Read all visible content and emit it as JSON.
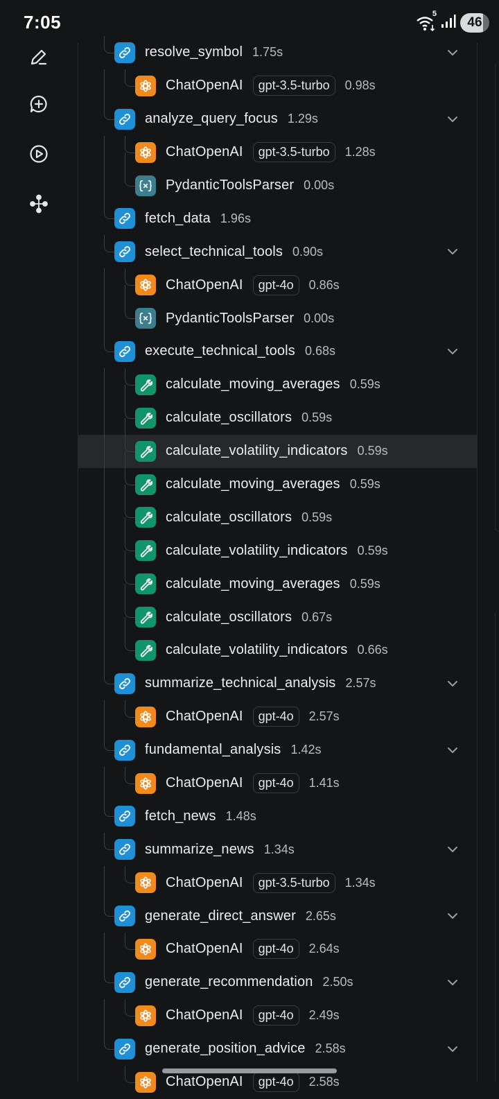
{
  "status_bar": {
    "time": "7:05",
    "wifi_badge": "5",
    "battery": "46"
  },
  "rail": {
    "icons": [
      "edit-icon",
      "new-chat-icon",
      "play-icon",
      "graph-icon"
    ]
  },
  "tree": [
    {
      "level": 0,
      "kind": "chain",
      "name": "resolve_symbol",
      "duration": "1.75s",
      "chevron": true
    },
    {
      "level": 1,
      "kind": "llm",
      "name": "ChatOpenAI",
      "model": "gpt-3.5-turbo",
      "duration": "0.98s"
    },
    {
      "level": 0,
      "kind": "chain",
      "name": "analyze_query_focus",
      "duration": "1.29s",
      "chevron": true
    },
    {
      "level": 1,
      "kind": "llm",
      "name": "ChatOpenAI",
      "model": "gpt-3.5-turbo",
      "duration": "1.28s"
    },
    {
      "level": 1,
      "kind": "parser",
      "name": "PydanticToolsParser",
      "duration": "0.00s"
    },
    {
      "level": 0,
      "kind": "chain",
      "name": "fetch_data",
      "duration": "1.96s",
      "chevron": false
    },
    {
      "level": 0,
      "kind": "chain",
      "name": "select_technical_tools",
      "duration": "0.90s",
      "chevron": true
    },
    {
      "level": 1,
      "kind": "llm",
      "name": "ChatOpenAI",
      "model": "gpt-4o",
      "duration": "0.86s"
    },
    {
      "level": 1,
      "kind": "parser",
      "name": "PydanticToolsParser",
      "duration": "0.00s"
    },
    {
      "level": 0,
      "kind": "chain",
      "name": "execute_technical_tools",
      "duration": "0.68s",
      "chevron": true
    },
    {
      "level": 1,
      "kind": "tool",
      "name": "calculate_moving_averages",
      "duration": "0.59s"
    },
    {
      "level": 1,
      "kind": "tool",
      "name": "calculate_oscillators",
      "duration": "0.59s"
    },
    {
      "level": 1,
      "kind": "tool",
      "name": "calculate_volatility_indicators",
      "duration": "0.59s",
      "highlighted": true
    },
    {
      "level": 1,
      "kind": "tool",
      "name": "calculate_moving_averages",
      "duration": "0.59s"
    },
    {
      "level": 1,
      "kind": "tool",
      "name": "calculate_oscillators",
      "duration": "0.59s"
    },
    {
      "level": 1,
      "kind": "tool",
      "name": "calculate_volatility_indicators",
      "duration": "0.59s"
    },
    {
      "level": 1,
      "kind": "tool",
      "name": "calculate_moving_averages",
      "duration": "0.59s"
    },
    {
      "level": 1,
      "kind": "tool",
      "name": "calculate_oscillators",
      "duration": "0.67s"
    },
    {
      "level": 1,
      "kind": "tool",
      "name": "calculate_volatility_indicators",
      "duration": "0.66s"
    },
    {
      "level": 0,
      "kind": "chain",
      "name": "summarize_technical_analysis",
      "duration": "2.57s",
      "chevron": true
    },
    {
      "level": 1,
      "kind": "llm",
      "name": "ChatOpenAI",
      "model": "gpt-4o",
      "duration": "2.57s"
    },
    {
      "level": 0,
      "kind": "chain",
      "name": "fundamental_analysis",
      "duration": "1.42s",
      "chevron": true
    },
    {
      "level": 1,
      "kind": "llm",
      "name": "ChatOpenAI",
      "model": "gpt-4o",
      "duration": "1.41s"
    },
    {
      "level": 0,
      "kind": "chain",
      "name": "fetch_news",
      "duration": "1.48s",
      "chevron": false
    },
    {
      "level": 0,
      "kind": "chain",
      "name": "summarize_news",
      "duration": "1.34s",
      "chevron": true
    },
    {
      "level": 1,
      "kind": "llm",
      "name": "ChatOpenAI",
      "model": "gpt-3.5-turbo",
      "duration": "1.34s"
    },
    {
      "level": 0,
      "kind": "chain",
      "name": "generate_direct_answer",
      "duration": "2.65s",
      "chevron": true
    },
    {
      "level": 1,
      "kind": "llm",
      "name": "ChatOpenAI",
      "model": "gpt-4o",
      "duration": "2.64s"
    },
    {
      "level": 0,
      "kind": "chain",
      "name": "generate_recommendation",
      "duration": "2.50s",
      "chevron": true
    },
    {
      "level": 1,
      "kind": "llm",
      "name": "ChatOpenAI",
      "model": "gpt-4o",
      "duration": "2.49s"
    },
    {
      "level": 0,
      "kind": "chain",
      "name": "generate_position_advice",
      "duration": "2.58s",
      "chevron": true
    },
    {
      "level": 1,
      "kind": "llm",
      "name": "ChatOpenAI",
      "model": "gpt-4o",
      "duration": "2.58s"
    }
  ]
}
